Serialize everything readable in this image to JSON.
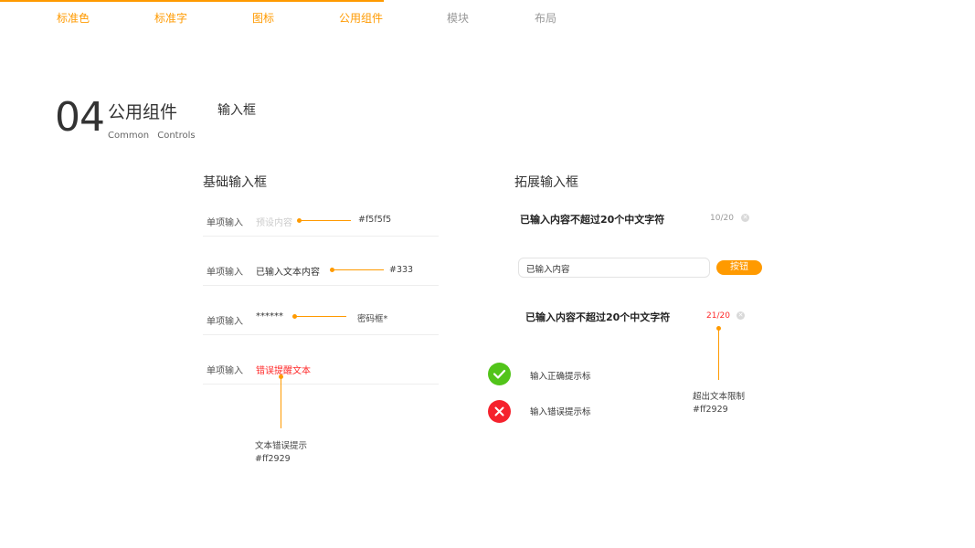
{
  "nav": {
    "items": [
      {
        "label": "标准色",
        "active": true
      },
      {
        "label": "标准字",
        "active": true
      },
      {
        "label": "图标",
        "active": true
      },
      {
        "label": "公用组件",
        "active": true
      },
      {
        "label": "模块",
        "active": false
      },
      {
        "label": "布局",
        "active": false
      }
    ]
  },
  "header": {
    "number": "04",
    "title": "公用组件",
    "subtitle": "Common Controls",
    "item": "输入框"
  },
  "basic": {
    "title": "基础输入框",
    "rows": [
      {
        "label": "单项输入",
        "value": "预设内容",
        "annotation": "#f5f5f5"
      },
      {
        "label": "单项输入",
        "value": "已输入文本内容",
        "annotation": "#333"
      },
      {
        "label": "单项输入",
        "value": "******",
        "annotation": "密码框*"
      },
      {
        "label": "单项输入",
        "value": "错误提醒文本"
      }
    ],
    "error_note": {
      "title": "文本错误提示",
      "color": "#ff2929"
    }
  },
  "extended": {
    "title": "拓展输入框",
    "field1": {
      "text": "已输入内容不超过20个中文字符",
      "counter": "10/20"
    },
    "field2": {
      "value": "已输入内容",
      "button": "按钮"
    },
    "field3": {
      "text": "已输入内容不超过20个中文字符",
      "counter": "21/20"
    },
    "correct": {
      "label": "输入正确提示标"
    },
    "wrong": {
      "label": "输入错误提示标"
    },
    "limit_note": {
      "title": "超出文本限制",
      "color": "#ff2929"
    }
  },
  "colors": {
    "accent": "#ff9a00",
    "placeholder": "#cccccc",
    "error": "#ff2929",
    "success": "#52c41a",
    "danger": "#f5222d"
  }
}
